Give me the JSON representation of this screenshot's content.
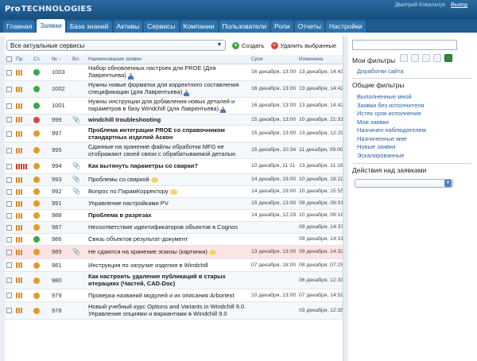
{
  "header": {
    "logo_part1": "Pro",
    "logo_part2": "TECHNOLOGIES",
    "user": "Дмитрий Ковальчук",
    "exit_label": "Выход"
  },
  "nav": {
    "tabs": [
      {
        "label": "Главная"
      },
      {
        "label": "Заявки"
      },
      {
        "label": "База знаний"
      },
      {
        "label": "Активы"
      },
      {
        "label": "Сервисы"
      },
      {
        "label": "Компании"
      },
      {
        "label": "Пользователи"
      },
      {
        "label": "Роли"
      },
      {
        "label": "Отчеты"
      },
      {
        "label": "Настройки"
      }
    ],
    "active_tab": "Заявки"
  },
  "toolbar": {
    "service_filter": "Все актуальные сервисы",
    "create_label": "Создать",
    "delete_label": "Удалить выбранные"
  },
  "table": {
    "columns": [
      "Пр.",
      "Ст.",
      "№",
      "Вл.",
      "Наименование заявки",
      "Срок",
      "Изменена"
    ],
    "sort_indicator": "↑",
    "rows": [
      {
        "prio": "orange",
        "status": "green",
        "num": "1003",
        "clip": false,
        "title": "Набор обновленных настроек для PROE (Для Лаврентьева)",
        "extra": "person",
        "bold": false,
        "due": "16 декабря, 13:00",
        "changed": "13 декабря, 14:43"
      },
      {
        "prio": "orange",
        "status": "green",
        "num": "1002",
        "clip": false,
        "title": "Нужны новые форматки для корректного составления спецификации (для Лаврентьева)",
        "extra": "person",
        "bold": false,
        "due": "16 декабря, 13:00",
        "changed": "13 декабря, 14:42"
      },
      {
        "prio": "orange",
        "status": "green",
        "num": "1001",
        "clip": false,
        "title": "Нужны инструкции для добавления новых деталей и параметров в базу Windchill (для Лаврентьева)",
        "extra": "person",
        "bold": false,
        "due": "16 декабря, 13:00",
        "changed": "13 декабря, 14:42"
      },
      {
        "prio": "orange",
        "status": "red",
        "num": "999",
        "clip": true,
        "title": "windchill troubleshooting",
        "extra": "",
        "bold": true,
        "due": "15 декабря, 13:00",
        "changed": "10 декабря, 21:31"
      },
      {
        "prio": "orange",
        "status": "orange",
        "num": "997",
        "clip": false,
        "title": "Проблема интеграции PROE со справочником стандартных изделий Аскон",
        "extra": "",
        "bold": true,
        "due": "15 декабря, 13:00",
        "changed": "13 декабря, 12:29"
      },
      {
        "prio": "orange",
        "status": "orange",
        "num": "995",
        "clip": false,
        "title": "Сданные на хранение файлы обработки MFG не отображают своей связи с обрабатываемой деталью",
        "extra": "",
        "bold": false,
        "due": "15 декабря, 10:34",
        "changed": "11 декабря, 09:00"
      },
      {
        "prio": "red",
        "status": "orange",
        "num": "994",
        "clip": true,
        "title": "Как вытянуть параметры со сварки?",
        "extra": "",
        "bold": true,
        "due": "10 декабря, 11:11",
        "changed": "13 декабря, 11:16"
      },
      {
        "prio": "orange",
        "status": "orange",
        "num": "993",
        "clip": true,
        "title": "Проблемы со сваркой",
        "extra": "bubble",
        "bold": false,
        "due": "14 декабря, 19:00",
        "changed": "10 декабря, 18:22"
      },
      {
        "prio": "orange",
        "status": "orange",
        "num": "992",
        "clip": true,
        "title": "Вопрос по ПарамКорректору",
        "extra": "bubble",
        "bold": false,
        "due": "14 декабря, 19:00",
        "changed": "10 декабря, 15:55"
      },
      {
        "prio": "orange",
        "status": "orange",
        "num": "991",
        "clip": false,
        "title": "Управление настройками PV",
        "extra": "",
        "bold": false,
        "due": "15 декабря, 13:00",
        "changed": "09 декабря, 09:01"
      },
      {
        "prio": "orange",
        "status": "orange",
        "num": "988",
        "clip": false,
        "title": "Проблема в разрезах",
        "extra": "",
        "bold": true,
        "due": "14 декабря, 12:29",
        "changed": "10 декабря, 09:18"
      },
      {
        "prio": "orange",
        "status": "orange",
        "num": "987",
        "clip": false,
        "title": "Несоответствие идентификаторов объектов в Cognos",
        "extra": "",
        "bold": false,
        "due": "",
        "changed": "09 декабря, 14:37"
      },
      {
        "prio": "orange",
        "status": "green",
        "num": "986",
        "clip": false,
        "title": "Связь объектов результат-документ",
        "extra": "",
        "bold": false,
        "due": "",
        "changed": "09 декабря, 14:31"
      },
      {
        "prio": "orange",
        "status": "orange",
        "num": "985",
        "clip": true,
        "title": "Не сдаются на хранение эскизы (картинки)",
        "extra": "bubble",
        "bold": false,
        "due": "13 декабря, 13:00",
        "changed": "09 декабря, 14:32",
        "highlight": true
      },
      {
        "prio": "orange",
        "status": "orange",
        "num": "981",
        "clip": false,
        "title": "Инструкция по загрузке изделия в Windchill",
        "extra": "",
        "bold": false,
        "due": "07 декабря, 18:00",
        "changed": "08 декабря, 07:25"
      },
      {
        "prio": "orange",
        "status": "orange",
        "num": "980",
        "clip": false,
        "title": "Как настроить удаление публикаций в старых итерациях (Частей, CAD-Doc)",
        "extra": "",
        "bold": true,
        "due": "",
        "changed": "06 декабря, 12:33"
      },
      {
        "prio": "orange",
        "status": "orange",
        "num": "979",
        "clip": false,
        "title": "Проверка названий модулей и их описания Arbortext",
        "extra": "",
        "bold": false,
        "due": "10 декабря, 13:00",
        "changed": "07 декабря, 14:59"
      },
      {
        "prio": "orange",
        "status": "orange",
        "num": "978",
        "clip": false,
        "title": "Новый учебный курс Options and Variants in Windchill 9.0. Управление опциями и вариантами в Windchill 9.0",
        "extra": "",
        "bold": false,
        "due": "",
        "changed": "03 декабря, 12:35"
      }
    ]
  },
  "sidebar": {
    "my_filters_title": "Мои фильтры",
    "my_filters_link": "Доработки сайта",
    "common_filters_title": "Общие фильтры",
    "common_filters": [
      "Выполненные мной",
      "Заявки без исполнителя",
      "Истек срок исполнения",
      "Мои заявки",
      "Назначен наблюдателем",
      "Назначенные мне",
      "Новые заявки",
      "Эскалированные"
    ],
    "actions_title": "Действия над заявками"
  },
  "colors": {
    "header_bg": "#174e7e",
    "nav_bg": "#1d5a8e",
    "link": "#2b62a3",
    "priority_orange": "#d98b2a",
    "priority_red": "#d23d2d",
    "status_green": "#3aa845",
    "status_orange": "#e39a2b",
    "status_red": "#d24a3b",
    "highlight_row": "#fde4e4"
  },
  "icons": {
    "create": "plus-circle-icon",
    "delete": "minus-circle-icon",
    "attachment": "paperclip-icon",
    "comment": "speech-bubble-icon",
    "assignee": "person-icon"
  }
}
